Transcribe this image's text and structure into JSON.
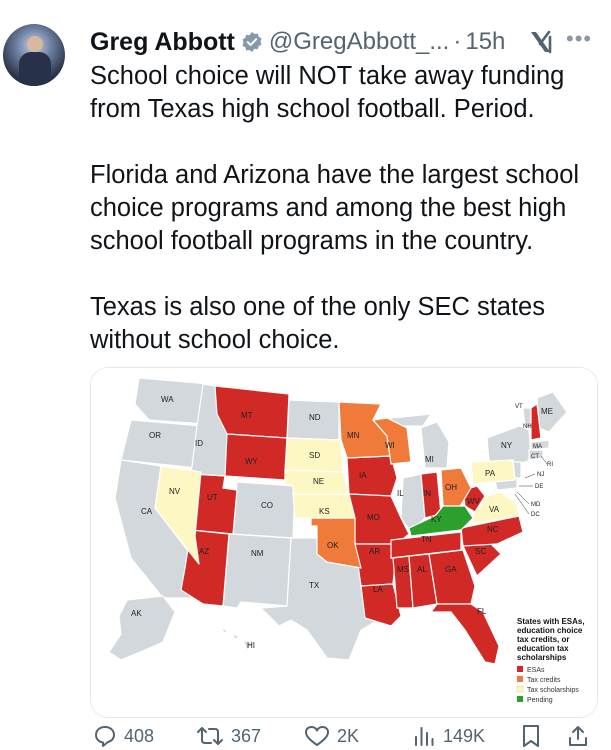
{
  "author": {
    "name": "Greg Abbott",
    "handle": "@GregAbbott_...",
    "separator": "·",
    "time": "15h"
  },
  "tweet": {
    "paragraphs": [
      "School choice will NOT take away funding from Texas high school football. Period.",
      "Florida and Arizona have the largest school choice programs and among the best high school football programs in the country.",
      "Texas is also one of the only SEC states without school choice."
    ]
  },
  "map": {
    "legend_title": [
      "States with ESAs,",
      "education choice",
      "tax credits, or",
      "education tax",
      "scholarships"
    ],
    "legend_items": [
      {
        "label": "ESAs",
        "color": "#d12a26"
      },
      {
        "label": "Tax credits",
        "color": "#f07a3a"
      },
      {
        "label": "Tax scholarships",
        "color": "#fdf7c4"
      },
      {
        "label": "Pending",
        "color": "#2ca02c"
      }
    ],
    "colors": {
      "esa": "#d12a26",
      "tax_credit": "#f07a3a",
      "tax_scholarship": "#fdf7c4",
      "pending": "#2ca02c",
      "none": "#d3d8dc"
    },
    "state_labels": [
      "WA",
      "OR",
      "CA",
      "ID",
      "NV",
      "MT",
      "WY",
      "UT",
      "AZ",
      "CO",
      "NM",
      "ND",
      "SD",
      "NE",
      "KS",
      "OK",
      "TX",
      "MN",
      "IA",
      "MO",
      "AR",
      "LA",
      "WI",
      "IL",
      "MI",
      "IN",
      "OH",
      "KY",
      "TN",
      "MS",
      "AL",
      "GA",
      "FL",
      "SC",
      "NC",
      "VA",
      "WV",
      "PA",
      "NY",
      "VT",
      "NH",
      "ME",
      "MA",
      "CT",
      "RI",
      "NJ",
      "DE",
      "MD",
      "DC",
      "AK",
      "HI"
    ]
  },
  "actions": {
    "replies": "408",
    "reposts": "367",
    "likes": "2K",
    "views": "149K"
  }
}
